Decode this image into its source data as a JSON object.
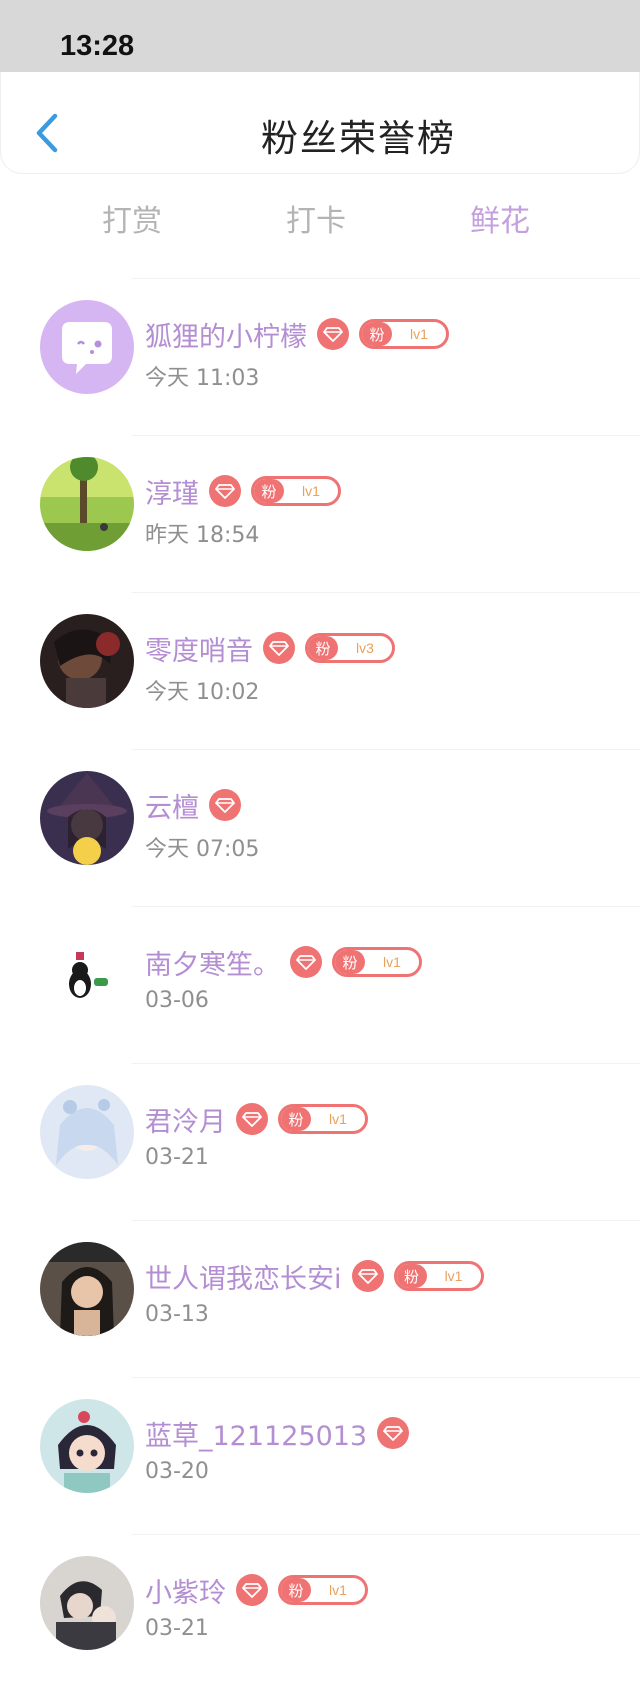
{
  "status_bar": {
    "time": "13:28"
  },
  "nav": {
    "title": "粉丝荣誉榜",
    "back_icon": "chevron-left-icon"
  },
  "tabs": [
    {
      "label": "打赏",
      "active": false
    },
    {
      "label": "打卡",
      "active": false
    },
    {
      "label": "鲜花",
      "active": true
    }
  ],
  "colors": {
    "accent": "#c5a0df",
    "name": "#b48ed3",
    "badge": "#f07374",
    "back": "#3a9be0"
  },
  "fans": [
    {
      "name": "狐狸的小柠檬",
      "time": "今天 11:03",
      "badge_label": "粉",
      "level": "lv1"
    },
    {
      "name": "淳瑾",
      "time": "昨天 18:54",
      "badge_label": "粉",
      "level": "lv1"
    },
    {
      "name": "零度哨音",
      "time": "今天 10:02",
      "badge_label": "粉",
      "level": "lv3"
    },
    {
      "name": "云檀",
      "time": "今天 07:05"
    },
    {
      "name": "南夕寒笙。",
      "time": "03-06",
      "badge_label": "粉",
      "level": "lv1"
    },
    {
      "name": "君泠月",
      "time": "03-21",
      "badge_label": "粉",
      "level": "lv1"
    },
    {
      "name": "世人谓我恋长安i",
      "time": "03-13",
      "badge_label": "粉",
      "level": "lv1"
    },
    {
      "name": "蓝草_121125013",
      "time": "03-20"
    },
    {
      "name": "小紫玲",
      "time": "03-21",
      "badge_label": "粉",
      "level": "lv1"
    }
  ]
}
